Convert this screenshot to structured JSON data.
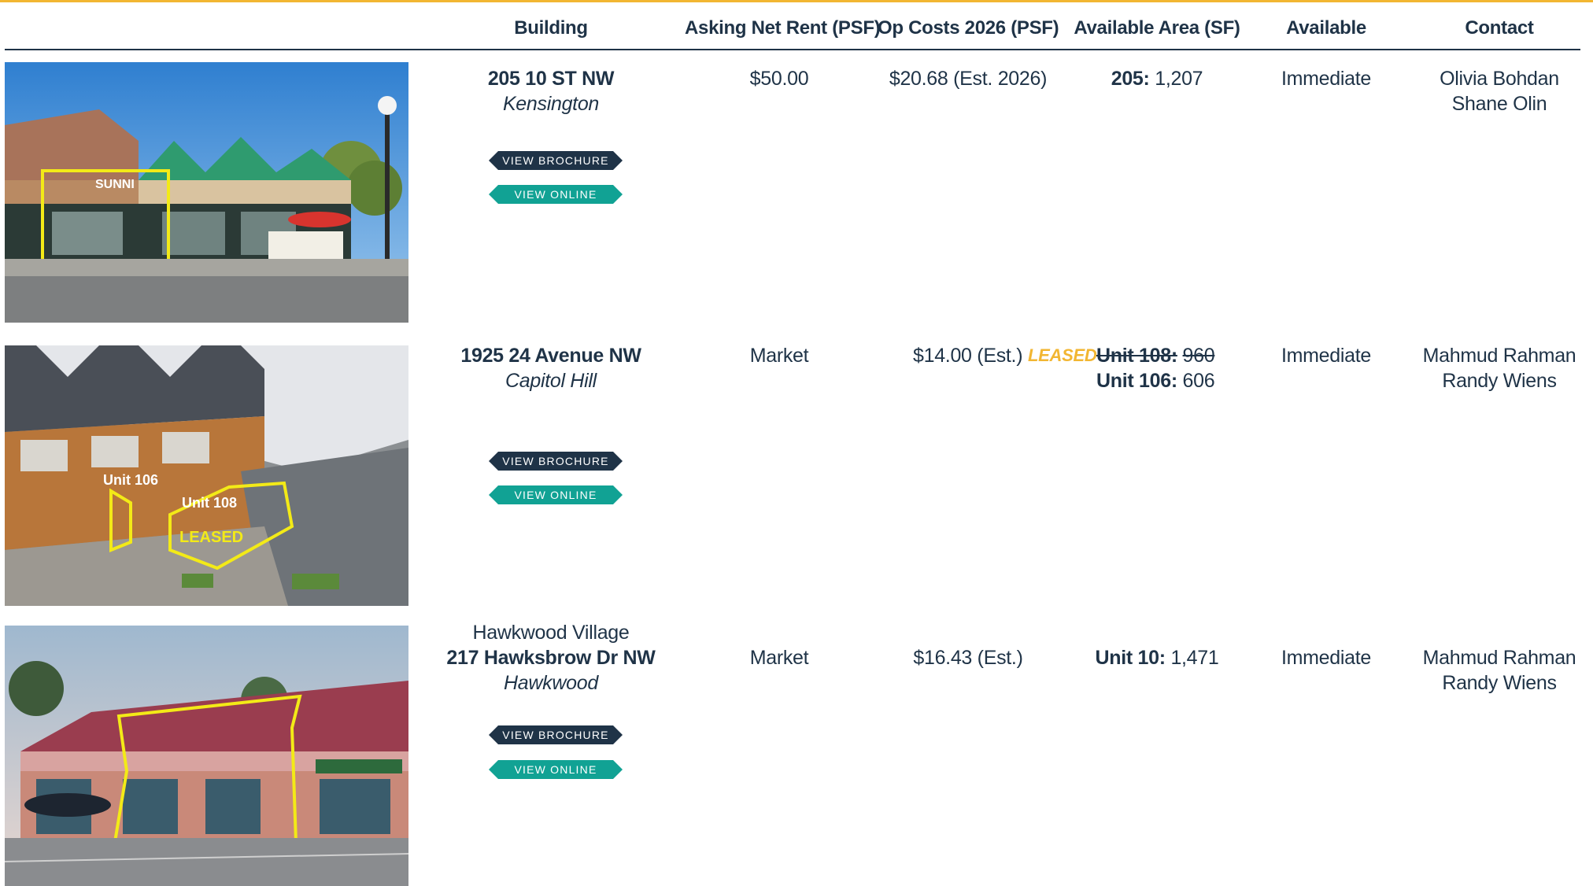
{
  "headers": {
    "building": "Building",
    "asking": "Asking Net Rent (PSF)",
    "opcosts": "Op Costs 2026 (PSF)",
    "area": "Available Area (SF)",
    "available": "Available",
    "contact": "Contact"
  },
  "buttons": {
    "brochure": "VIEW BROCHURE",
    "online": "VIEW ONLINE"
  },
  "listings": [
    {
      "address": "205 10 ST NW",
      "neighbourhood": "Kensington",
      "asking": "$50.00",
      "opcosts": "$20.68 (Est. 2026)",
      "areas": [
        {
          "unit": "205:",
          "sf": "1,207"
        }
      ],
      "available": "Immediate",
      "contacts": [
        "Olivia Bohdan",
        "Shane Olin"
      ],
      "photo_sign": "SUNNI"
    },
    {
      "address": "1925 24 Avenue NW",
      "neighbourhood": "Capitol Hill",
      "asking": "Market",
      "opcosts": "$14.00 (Est.)",
      "leased_tag": "LEASED",
      "areas": [
        {
          "unit": "Unit 108:",
          "sf": "960",
          "leased": true
        },
        {
          "unit": "Unit 106:",
          "sf": "606"
        }
      ],
      "available": "Immediate",
      "contacts": [
        "Mahmud Rahman",
        "Randy Wiens"
      ],
      "photo_labels": {
        "unit106": "Unit 106",
        "unit108": "Unit 108",
        "leased": "LEASED"
      }
    },
    {
      "pre_title": "Hawkwood Village",
      "address": "217 Hawksbrow Dr NW",
      "neighbourhood": "Hawkwood",
      "asking": "Market",
      "opcosts": "$16.43 (Est.)",
      "areas": [
        {
          "unit": "Unit 10:",
          "sf": "1,471"
        }
      ],
      "available": "Immediate",
      "contacts": [
        "Mahmud Rahman",
        "Randy Wiens"
      ]
    }
  ],
  "colors": {
    "navy": "#1f3347",
    "teal": "#11a294",
    "gold": "#f2b632"
  }
}
